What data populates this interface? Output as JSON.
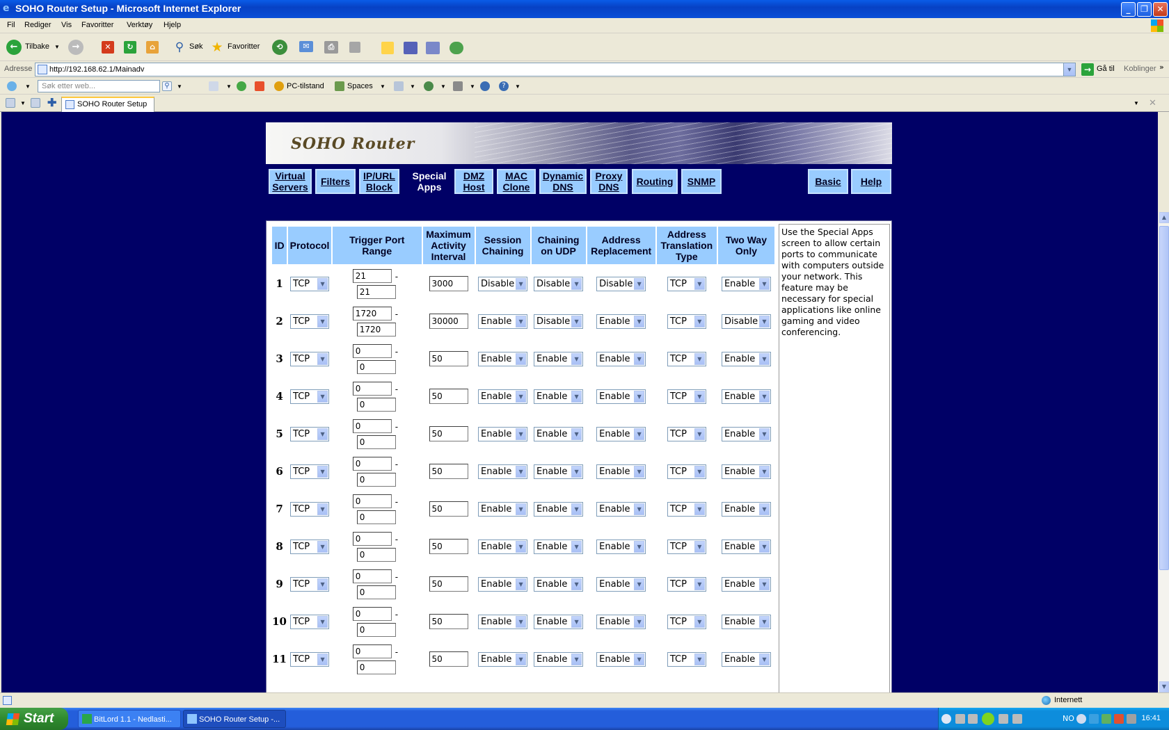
{
  "window": {
    "title": "SOHO Router Setup - Microsoft Internet Explorer"
  },
  "menu": [
    "Fil",
    "Rediger",
    "Vis",
    "Favoritter",
    "Verktøy",
    "Hjelp"
  ],
  "toolbar": {
    "back": "Tilbake",
    "search": "Søk",
    "favorites": "Favoritter"
  },
  "address": {
    "label": "Adresse",
    "url": "http://192.168.62.1/Mainadv",
    "go": "Gå til",
    "links": "Koblinger"
  },
  "searchbar": {
    "placeholder": "Søk etter web...",
    "pc_state": "PC-tilstand",
    "spaces": "Spaces"
  },
  "tab": {
    "title": "SOHO Router Setup"
  },
  "page": {
    "logo": "SOHO Router",
    "nav": [
      {
        "l1": "Virtual",
        "l2": "Servers"
      },
      {
        "l1": "Filters",
        "l2": ""
      },
      {
        "l1": "IP/URL",
        "l2": "Block"
      },
      {
        "l1": "Special",
        "l2": "Apps"
      },
      {
        "l1": "DMZ",
        "l2": "Host"
      },
      {
        "l1": "MAC",
        "l2": "Clone"
      },
      {
        "l1": "Dynamic",
        "l2": "DNS"
      },
      {
        "l1": "Proxy",
        "l2": "DNS"
      },
      {
        "l1": "Routing",
        "l2": ""
      },
      {
        "l1": "SNMP",
        "l2": ""
      },
      {
        "l1": "Basic",
        "l2": ""
      },
      {
        "l1": "Help",
        "l2": ""
      }
    ],
    "headers": {
      "id": "ID",
      "protocol": "Protocol",
      "trigger_l1": "Trigger Port",
      "trigger_l2": "Range",
      "max_l1": "Maximum",
      "max_l2": "Activity",
      "max_l3": "Interval",
      "session_l1": "Session",
      "session_l2": "Chaining",
      "chudp_l1": "Chaining",
      "chudp_l2": "on UDP",
      "addr_l1": "Address",
      "addr_l2": "Replacement",
      "att_l1": "Address",
      "att_l2": "Translation",
      "att_l3": "Type",
      "twoway_l1": "Two Way",
      "twoway_l2": "Only"
    },
    "rows": [
      {
        "id": "1",
        "protocol": "TCP",
        "port_from": "21",
        "port_to": "21",
        "interval": "3000",
        "session": "Disable",
        "chaining_udp": "Disable",
        "addr_repl": "Disable",
        "att": "TCP",
        "two_way": "Enable"
      },
      {
        "id": "2",
        "protocol": "TCP",
        "port_from": "1720",
        "port_to": "1720",
        "interval": "30000",
        "session": "Enable",
        "chaining_udp": "Disable",
        "addr_repl": "Enable",
        "att": "TCP",
        "two_way": "Disable"
      },
      {
        "id": "3",
        "protocol": "TCP",
        "port_from": "0",
        "port_to": "0",
        "interval": "50",
        "session": "Enable",
        "chaining_udp": "Enable",
        "addr_repl": "Enable",
        "att": "TCP",
        "two_way": "Enable"
      },
      {
        "id": "4",
        "protocol": "TCP",
        "port_from": "0",
        "port_to": "0",
        "interval": "50",
        "session": "Enable",
        "chaining_udp": "Enable",
        "addr_repl": "Enable",
        "att": "TCP",
        "two_way": "Enable"
      },
      {
        "id": "5",
        "protocol": "TCP",
        "port_from": "0",
        "port_to": "0",
        "interval": "50",
        "session": "Enable",
        "chaining_udp": "Enable",
        "addr_repl": "Enable",
        "att": "TCP",
        "two_way": "Enable"
      },
      {
        "id": "6",
        "protocol": "TCP",
        "port_from": "0",
        "port_to": "0",
        "interval": "50",
        "session": "Enable",
        "chaining_udp": "Enable",
        "addr_repl": "Enable",
        "att": "TCP",
        "two_way": "Enable"
      },
      {
        "id": "7",
        "protocol": "TCP",
        "port_from": "0",
        "port_to": "0",
        "interval": "50",
        "session": "Enable",
        "chaining_udp": "Enable",
        "addr_repl": "Enable",
        "att": "TCP",
        "two_way": "Enable"
      },
      {
        "id": "8",
        "protocol": "TCP",
        "port_from": "0",
        "port_to": "0",
        "interval": "50",
        "session": "Enable",
        "chaining_udp": "Enable",
        "addr_repl": "Enable",
        "att": "TCP",
        "two_way": "Enable"
      },
      {
        "id": "9",
        "protocol": "TCP",
        "port_from": "0",
        "port_to": "0",
        "interval": "50",
        "session": "Enable",
        "chaining_udp": "Enable",
        "addr_repl": "Enable",
        "att": "TCP",
        "two_way": "Enable"
      },
      {
        "id": "10",
        "protocol": "TCP",
        "port_from": "0",
        "port_to": "0",
        "interval": "50",
        "session": "Enable",
        "chaining_udp": "Enable",
        "addr_repl": "Enable",
        "att": "TCP",
        "two_way": "Enable"
      },
      {
        "id": "11",
        "protocol": "TCP",
        "port_from": "0",
        "port_to": "0",
        "interval": "50",
        "session": "Enable",
        "chaining_udp": "Enable",
        "addr_repl": "Enable",
        "att": "TCP",
        "two_way": "Enable"
      }
    ],
    "help_text": "Use the Special Apps screen to allow certain ports to communicate with computers outside your network. This feature may be necessary for special applications like online gaming and video conferencing."
  },
  "status": {
    "zone": "Internett"
  },
  "taskbar": {
    "start": "Start",
    "items": [
      "BitLord 1.1 - Nedlasti...",
      "SOHO Router Setup -..."
    ],
    "lang": "NO",
    "clock": "16:41"
  },
  "colors": {
    "page_bg": "#000066",
    "nav_bg": "#99ccff",
    "xp_blue": "#245edb"
  }
}
